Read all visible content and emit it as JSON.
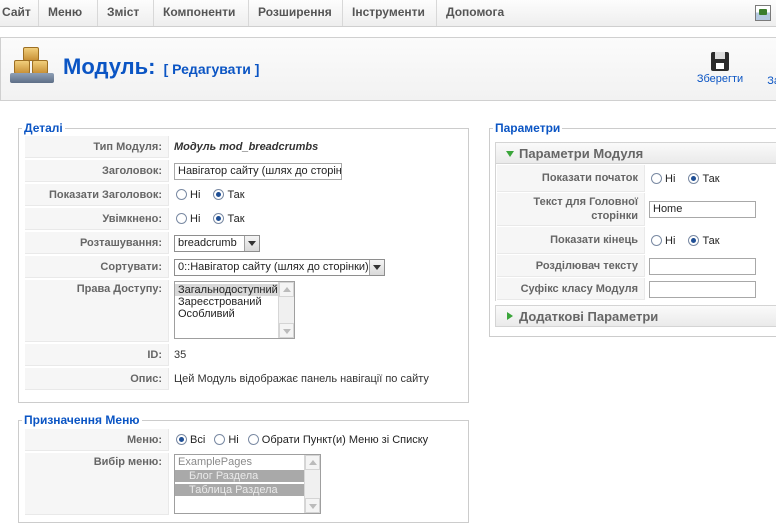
{
  "menu": {
    "items": [
      "Сайт",
      "Меню",
      "Зміст",
      "Компоненти",
      "Розширення",
      "Інструменти",
      "Допомога"
    ]
  },
  "toolbar": {
    "title": "Модуль:",
    "subtitle": "[ Редагувати ]",
    "save_label": "Зберегти",
    "close_label": "Зак"
  },
  "details": {
    "legend": "Деталі",
    "type_label": "Тип Модуля:",
    "type_value": "Модуль mod_breadcrumbs",
    "title_label": "Заголовок:",
    "title_value": "Навігатор сайту (шлях до сторінки)",
    "show_title_label": "Показати Заголовок:",
    "enabled_label": "Увімкнено:",
    "no": "Ні",
    "yes": "Так",
    "position_label": "Розташування:",
    "position_value": "breadcrumb",
    "order_label": "Сортувати:",
    "order_value": "0::Навігатор сайту (шлях до сторінки)",
    "access_label": "Права Доступу:",
    "access_options": [
      "Загальнодоступний",
      "Зареєстрований",
      "Особливий"
    ],
    "id_label": "ID:",
    "id_value": "35",
    "desc_label": "Опис:",
    "desc_value": "Цей Модуль відображає панель навігації по сайту"
  },
  "menu_assignment": {
    "legend": "Призначення Меню",
    "menus_label": "Меню:",
    "all": "Всі",
    "none": "Ні",
    "select": "Обрати Пункт(и) Меню зі Списку",
    "selection_label": "Вибір меню:",
    "options": [
      "ExamplePages",
      "Блог Раздела",
      "Таблица Раздела"
    ]
  },
  "params": {
    "legend": "Параметри",
    "module_params_title": "Параметри Модуля",
    "show_home_label": "Показати початок",
    "home_text_label": "Текст для Головної сторінки",
    "home_text_value": "Home",
    "show_last_label": "Показати кінець",
    "separator_label": "Розділювач тексту",
    "suffix_label": "Суфікс класу Модуля",
    "advanced_title": "Додаткові Параметри",
    "no": "Ні",
    "yes": "Так"
  }
}
